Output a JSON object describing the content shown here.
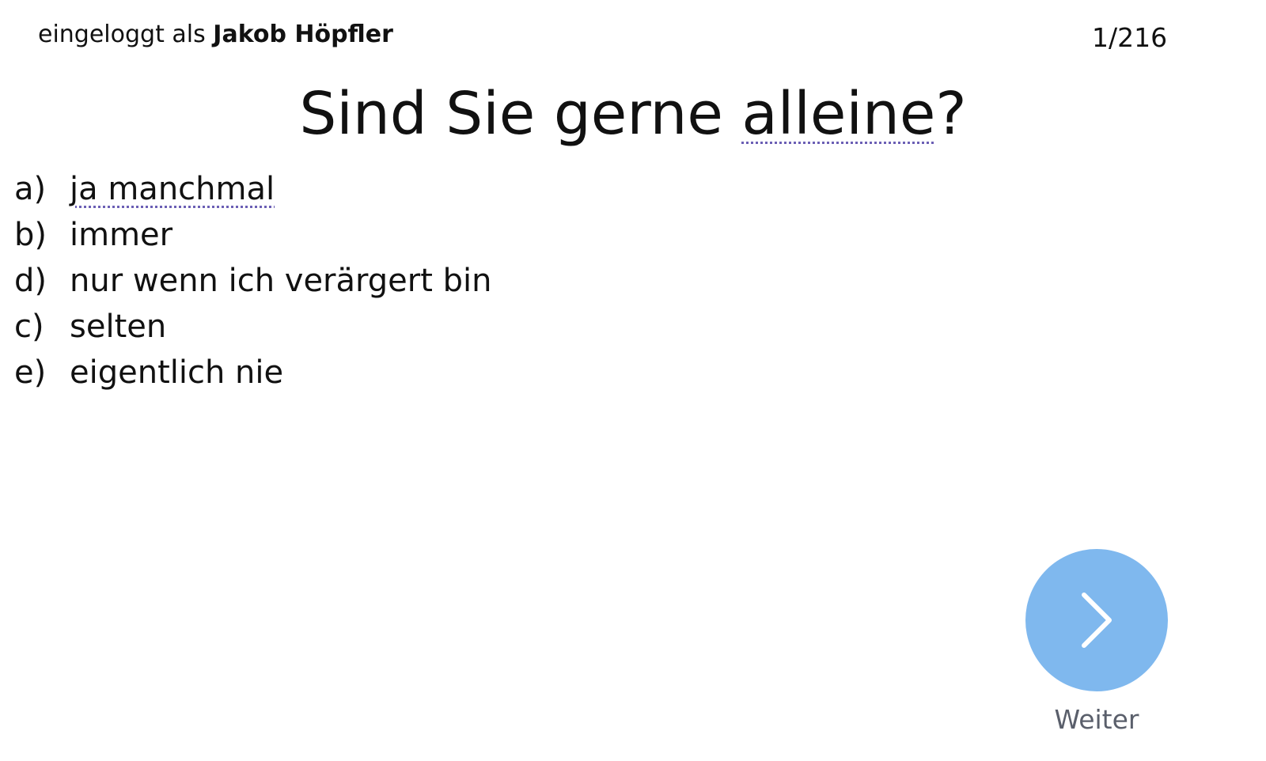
{
  "header": {
    "login_prefix": "eingeloggt als",
    "user_name": "Jakob Höpfler",
    "progress": "1/216"
  },
  "question": {
    "text_before": "Sind Sie gerne ",
    "underlined_word": "alleine",
    "text_after": "?"
  },
  "answers": [
    {
      "letter": "a)",
      "text": "ja manchmal"
    },
    {
      "letter": "b)",
      "text": "immer"
    },
    {
      "letter": "d)",
      "text": "nur wenn ich verärgert bin"
    },
    {
      "letter": "c)",
      "text": "selten"
    },
    {
      "letter": "e)",
      "text": "eigentlich nie"
    }
  ],
  "next_button": {
    "label": "Weiter",
    "icon": "chevron-right-icon",
    "color": "#7fb8ee"
  },
  "colors": {
    "spellcheck_underline": "#6b5fb5",
    "text": "#111111",
    "muted_label": "#5a5f6b"
  }
}
